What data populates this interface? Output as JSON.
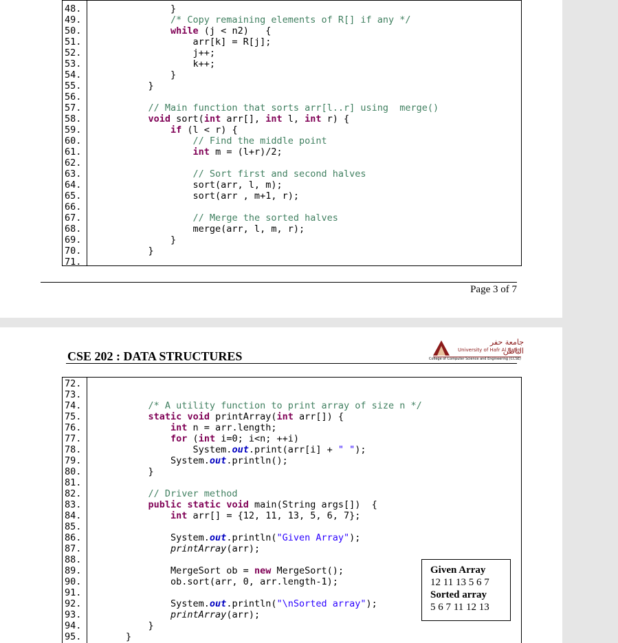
{
  "top_block": {
    "line_numbers": [
      "48.",
      "49.",
      "50.",
      "51.",
      "52.",
      "53.",
      "54.",
      "55.",
      "56.",
      "57.",
      "58.",
      "59.",
      "60.",
      "61.",
      "62.",
      "63.",
      "64.",
      "65.",
      "66.",
      "67.",
      "68.",
      "69.",
      "70.",
      "71."
    ],
    "lines": [
      "        }",
      "        /* Copy remaining elements of R[] if any */",
      "        while (j < n2)   {",
      "            arr[k] = R[j];",
      "            j++;",
      "            k++;",
      "        }",
      "    }",
      "",
      "    // Main function that sorts arr[l..r] using  merge()",
      "    void sort(int arr[], int l, int r) {",
      "        if (l < r) {",
      "            // Find the middle point",
      "            int m = (l+r)/2;",
      "",
      "            // Sort first and second halves",
      "            sort(arr, l, m);",
      "            sort(arr , m+1, r);",
      "",
      "            // Merge the sorted halves",
      "            merge(arr, l, m, r);",
      "        }",
      "    }",
      ""
    ]
  },
  "footer": {
    "page_label": "Page 3 of 7"
  },
  "header": {
    "course_title": "CSE 202 : DATA STRUCTURES",
    "logo_arabic": "جامعة حفر الباطن",
    "logo_english": "University of Hafr Al Batin",
    "logo_college": "College of Computer Science and Engineering (CCSE)"
  },
  "bottom_block": {
    "line_numbers": [
      "72.",
      "73.",
      "74.",
      "75.",
      "76.",
      "77.",
      "78.",
      "79.",
      "80.",
      "81.",
      "82.",
      "83.",
      "84.",
      "85.",
      "86.",
      "87.",
      "88.",
      "89.",
      "90.",
      "91.",
      "92.",
      "93.",
      "94.",
      "95."
    ],
    "lines": [
      "",
      "",
      "    /* A utility function to print array of size n */",
      "    static void printArray(int arr[]) {",
      "        int n = arr.length;",
      "        for (int i=0; i<n; ++i)",
      "            System.out.print(arr[i] + \" \");",
      "        System.out.println();",
      "    }",
      "",
      "    // Driver method",
      "    public static void main(String args[])  {",
      "        int arr[] = {12, 11, 13, 5, 6, 7};",
      "",
      "        System.out.println(\"Given Array\");",
      "        printArray(arr);",
      "",
      "        MergeSort ob = new MergeSort();",
      "        ob.sort(arr, 0, arr.length-1);",
      "",
      "        System.out.println(\"\\nSorted array\");",
      "        printArray(arr);",
      "    }",
      "}"
    ]
  },
  "output": {
    "given_label": "Given Array",
    "given_values": "12 11 13 5 6 7",
    "sorted_label": "Sorted array",
    "sorted_values": "5 6 7 11 12 13"
  }
}
